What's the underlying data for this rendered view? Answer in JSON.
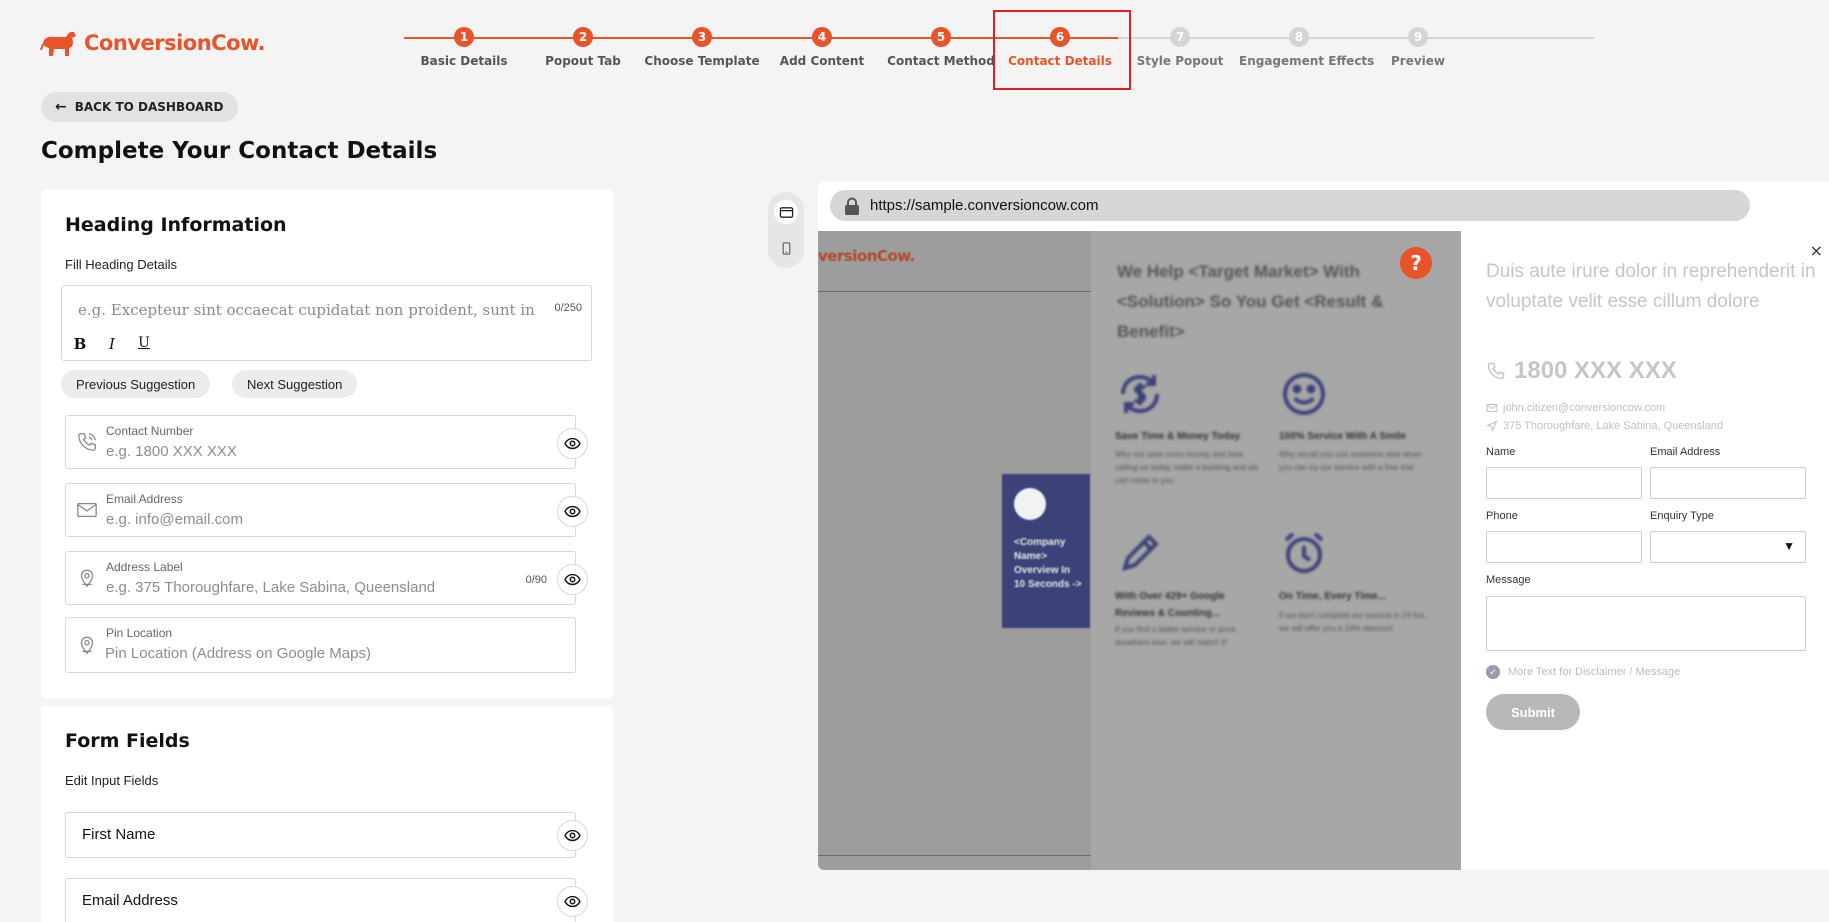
{
  "brand": {
    "name": "ConversionCow.",
    "color": "#e8532a"
  },
  "stepper": {
    "steps": [
      {
        "num": "1",
        "label": "Basic Details",
        "state": "done"
      },
      {
        "num": "2",
        "label": "Popout Tab",
        "state": "done"
      },
      {
        "num": "3",
        "label": "Choose Template",
        "state": "done"
      },
      {
        "num": "4",
        "label": "Add Content",
        "state": "done"
      },
      {
        "num": "5",
        "label": "Contact Method",
        "state": "done"
      },
      {
        "num": "6",
        "label": "Contact Details",
        "state": "current"
      },
      {
        "num": "7",
        "label": "Style Popout",
        "state": "todo"
      },
      {
        "num": "8",
        "label": "Engagement Effects",
        "state": "todo"
      },
      {
        "num": "9",
        "label": "Preview",
        "state": "todo"
      }
    ]
  },
  "nav": {
    "back_label": "BACK TO DASHBOARD"
  },
  "page": {
    "title": "Complete Your Contact Details"
  },
  "heading_card": {
    "title": "Heading Information",
    "subtitle": "Fill Heading Details",
    "heading_placeholder": "e.g. Excepteur sint occaecat cupidatat non proident, sunt in",
    "heading_counter": "0/250",
    "format": {
      "bold": "B",
      "italic": "I",
      "underline": "U"
    },
    "prev_suggestion": "Previous Suggestion",
    "next_suggestion": "Next Suggestion",
    "contact_number": {
      "label": "Contact Number",
      "placeholder": "e.g. 1800 XXX XXX"
    },
    "email": {
      "label": "Email Address",
      "placeholder": "e.g. info@email.com"
    },
    "address": {
      "label": "Address Label",
      "placeholder": "e.g. 375 Thoroughfare, Lake Sabina, Queensland",
      "counter": "0/90"
    },
    "pin": {
      "label": "Pin Location",
      "placeholder": "Pin Location (Address on Google Maps)"
    }
  },
  "form_card": {
    "title": "Form Fields",
    "subtitle": "Edit Input Fields",
    "fields": [
      "First Name",
      "Email Address"
    ]
  },
  "preview": {
    "url": "https://sample.conversioncow.com",
    "site_logo": "versionCow.",
    "navy_text": "<Company Name> Overview In 10 Seconds ->",
    "feature_heading": "We Help <Target Market> With <Solution> So You Get <Result & Benefit>",
    "features": [
      {
        "title": "Save Time & Money Today",
        "desc": "Why not save more money and time calling us today, make a booking and we can come to you"
      },
      {
        "title": "100% Service With A Smile",
        "desc": "Why would you use someone else when you can try our service with a free trial"
      },
      {
        "title": "With Over 429+ Google Reviews & Counting...",
        "desc": "If you find a better service or price anywhere else, we will match it!"
      },
      {
        "title": "On Time, Every Time...",
        "desc": "If we don't complete our service in 24 hrs, we will offer you a 10% discount"
      }
    ],
    "help_label": "?",
    "close_label": "×",
    "popout_heading": "Duis aute irure dolor in reprehenderit in voluptate velit esse cillum dolore",
    "popout_phone": "1800 XXX XXX",
    "popout_email": "john.citizen@conversioncow.com",
    "popout_address": "375 Thoroughfare, Lake Sabina, Queensland",
    "form": {
      "name_label": "Name",
      "email_label": "Email Address",
      "phone_label": "Phone",
      "enquiry_label": "Enquiry Type",
      "message_label": "Message",
      "disclaimer": "More Text for Disclaimer / Message",
      "submit": "Submit"
    }
  }
}
